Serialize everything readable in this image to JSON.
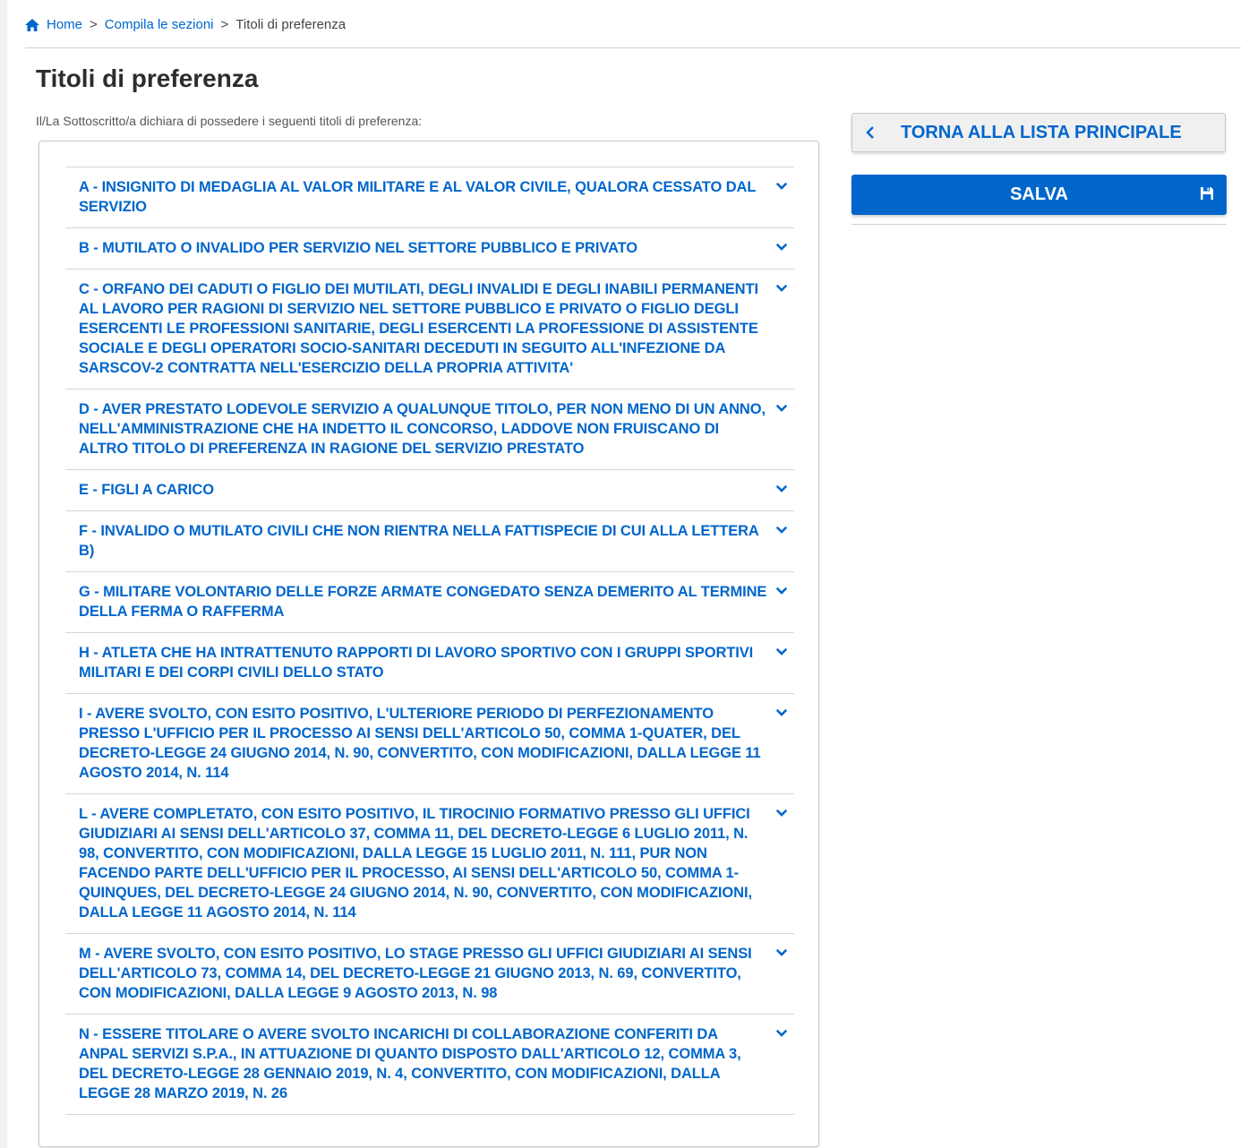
{
  "breadcrumb": {
    "home": "Home",
    "section": "Compila le sezioni",
    "current": "Titoli di preferenza",
    "separator": ">"
  },
  "page": {
    "title": "Titoli di preferenza",
    "intro": "Il/La Sottoscritto/a dichiara di possedere i seguenti titoli di preferenza:"
  },
  "accordion": {
    "items": [
      {
        "label": "A - INSIGNITO DI MEDAGLIA AL VALOR MILITARE E AL VALOR CIVILE, QUALORA CESSATO DAL SERVIZIO"
      },
      {
        "label": "B - MUTILATO O INVALIDO PER SERVIZIO NEL SETTORE PUBBLICO E PRIVATO"
      },
      {
        "label": "C - ORFANO DEI CADUTI O FIGLIO DEI MUTILATI, DEGLI INVALIDI E DEGLI INABILI PERMANENTI AL LAVORO PER RAGIONI DI SERVIZIO NEL SETTORE PUBBLICO E PRIVATO O FIGLIO DEGLI ESERCENTI LE PROFESSIONI SANITARIE, DEGLI ESERCENTI LA PROFESSIONE DI ASSISTENTE SOCIALE E DEGLI OPERATORI SOCIO-SANITARI DECEDUTI IN SEGUITO ALL'INFEZIONE DA SARSCOV-2 CONTRATTA NELL'ESERCIZIO DELLA PROPRIA ATTIVITA'"
      },
      {
        "label": "D - AVER PRESTATO LODEVOLE SERVIZIO A QUALUNQUE TITOLO, PER NON MENO DI UN ANNO, NELL'AMMINISTRAZIONE CHE HA INDETTO IL CONCORSO, LADDOVE NON FRUISCANO DI ALTRO TITOLO DI PREFERENZA IN RAGIONE DEL SERVIZIO PRESTATO"
      },
      {
        "label": "E - FIGLI A CARICO"
      },
      {
        "label": "F - INVALIDO O MUTILATO CIVILI CHE NON RIENTRA NELLA FATTISPECIE DI CUI ALLA LETTERA B)"
      },
      {
        "label": "G - MILITARE VOLONTARIO DELLE FORZE ARMATE CONGEDATO SENZA DEMERITO AL TERMINE DELLA FERMA O RAFFERMA"
      },
      {
        "label": "H - ATLETA CHE HA INTRATTENUTO RAPPORTI DI LAVORO SPORTIVO CON I GRUPPI SPORTIVI MILITARI E DEI CORPI CIVILI DELLO STATO"
      },
      {
        "label": "I - AVERE SVOLTO, CON ESITO POSITIVO, L'ULTERIORE PERIODO DI PERFEZIONAMENTO PRESSO L'UFFICIO PER IL PROCESSO AI SENSI DELL'ARTICOLO 50, COMMA 1-QUATER, DEL DECRETO-LEGGE 24 GIUGNO 2014, N. 90, CONVERTITO, CON MODIFICAZIONI, DALLA LEGGE 11 AGOSTO 2014, N. 114"
      },
      {
        "label": "L - AVERE COMPLETATO, CON ESITO POSITIVO, IL TIROCINIO FORMATIVO PRESSO GLI UFFICI GIUDIZIARI AI SENSI DELL'ARTICOLO 37, COMMA 11, DEL DECRETO-LEGGE 6 LUGLIO 2011, N. 98, CONVERTITO, CON MODIFICAZIONI, DALLA LEGGE 15 LUGLIO 2011, N. 111, PUR NON FACENDO PARTE DELL'UFFICIO PER IL PROCESSO, AI SENSI DELL'ARTICOLO 50, COMMA 1-QUINQUES, DEL DECRETO-LEGGE 24 GIUGNO 2014, N. 90, CONVERTITO, CON MODIFICAZIONI, DALLA LEGGE 11 AGOSTO 2014, N. 114"
      },
      {
        "label": "M - AVERE SVOLTO, CON ESITO POSITIVO, LO STAGE PRESSO GLI UFFICI GIUDIZIARI AI SENSI DELL'ARTICOLO 73, COMMA 14, DEL DECRETO-LEGGE 21 GIUGNO 2013, N. 69, CONVERTITO, CON MODIFICAZIONI, DALLA LEGGE 9 AGOSTO 2013, N. 98"
      },
      {
        "label": "N - ESSERE TITOLARE O AVERE SVOLTO INCARICHI DI COLLABORAZIONE CONFERITI DA ANPAL SERVIZI S.P.A., IN ATTUAZIONE DI QUANTO DISPOSTO DALL'ARTICOLO 12, COMMA 3, DEL DECRETO-LEGGE 28 GENNAIO 2019, N. 4, CONVERTITO, CON MODIFICAZIONI, DALLA LEGGE 28 MARZO 2019, N. 26"
      }
    ]
  },
  "actions": {
    "back_label": "TORNA ALLA LISTA PRINCIPALE",
    "save_label": "SALVA"
  },
  "icons": {
    "home": "home-icon",
    "chevron": "chevron-down-icon",
    "back": "chevron-left-icon",
    "save": "floppy-disk-icon"
  },
  "colors": {
    "accent": "#0066cc",
    "save_button": "#0066cc",
    "back_button": "#f0f0f0"
  }
}
